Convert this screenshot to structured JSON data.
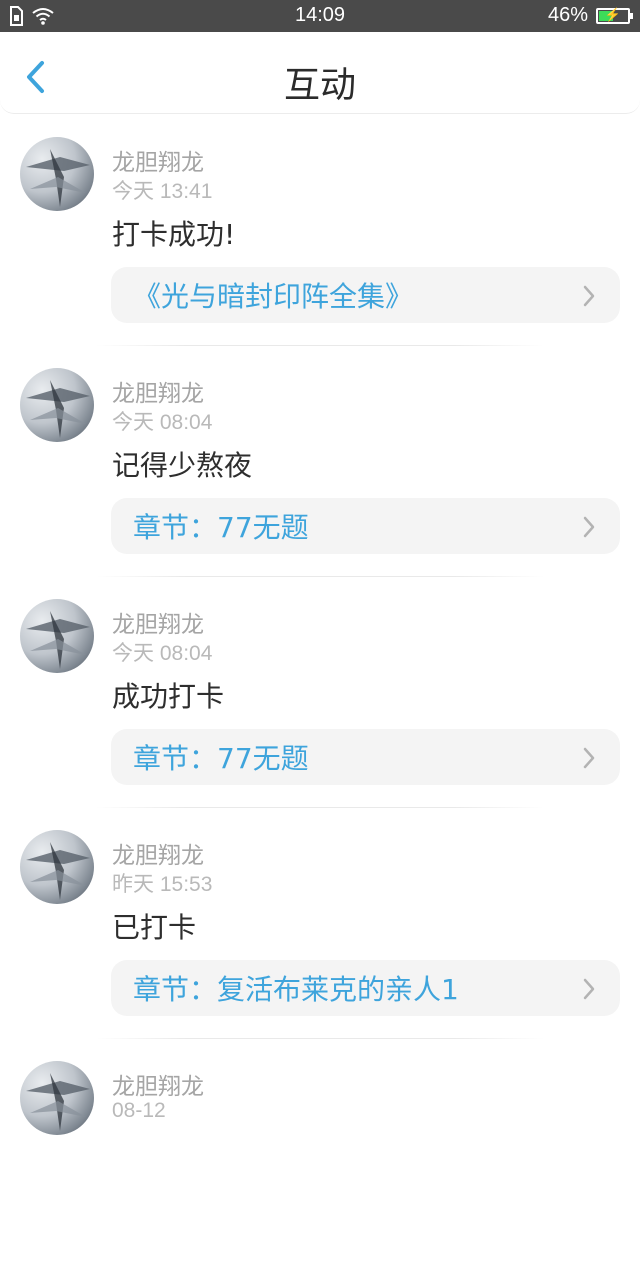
{
  "status_bar": {
    "time": "14:09",
    "battery_percent": "46%",
    "battery_level": 0.46,
    "icons": [
      "sim-card-icon",
      "wifi-icon",
      "battery-charging-icon"
    ]
  },
  "header": {
    "title": "互动",
    "back_icon": "chevron-left-icon"
  },
  "feed": [
    {
      "name": "龙胆翔龙",
      "time": "今天 13:41",
      "content": "打卡成功!",
      "ref": "《光与暗封印阵全集》"
    },
    {
      "name": "龙胆翔龙",
      "time": "今天 08:04",
      "content": "记得少熬夜",
      "ref": "章节：77无题"
    },
    {
      "name": "龙胆翔龙",
      "time": "今天 08:04",
      "content": "成功打卡",
      "ref": "章节：77无题"
    },
    {
      "name": "龙胆翔龙",
      "time": "昨天 15:53",
      "content": "已打卡",
      "ref": "章节：复活布莱克的亲人1"
    },
    {
      "name": "龙胆翔龙",
      "time": "08-12",
      "content": "",
      "ref": ""
    }
  ],
  "colors": {
    "accent": "#3ea4dc",
    "status_bar": "#4a4a4a",
    "battery_fill": "#3ddc59"
  }
}
